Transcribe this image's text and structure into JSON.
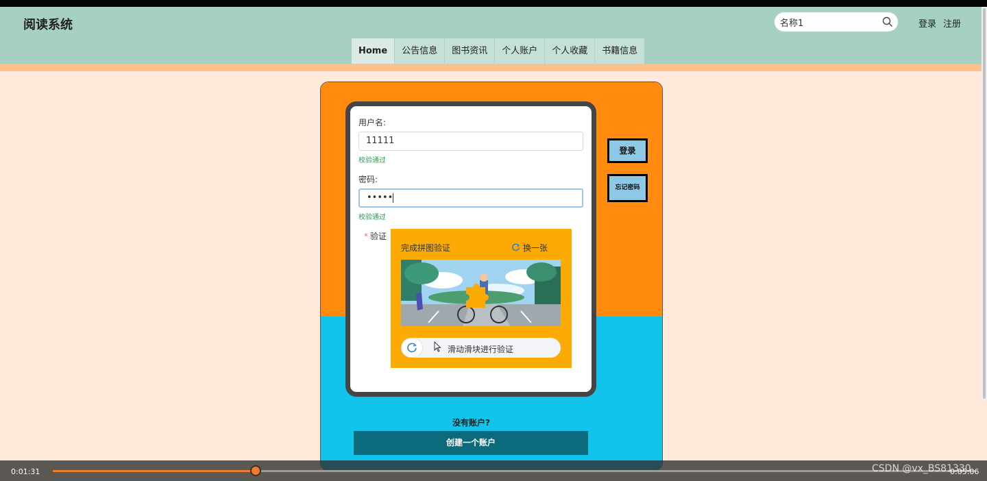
{
  "header": {
    "logo": "阅读系统",
    "search": {
      "value": "名称1"
    },
    "login": "登录",
    "register": "注册"
  },
  "nav": [
    "Home",
    "公告信息",
    "图书资讯",
    "个人账户",
    "个人收藏",
    "书籍信息"
  ],
  "form": {
    "username_label": "用户名:",
    "username_value": "11111",
    "username_status": "校验通过",
    "password_label": "密码:",
    "password_value": "•••••",
    "password_status": "校验通过",
    "captcha_required_mark": "*",
    "captcha_label": "验证"
  },
  "captcha": {
    "title": "完成拼图验证",
    "refresh": "换一张",
    "slider_text": "滑动滑块进行验证"
  },
  "side_buttons": {
    "login": "登录",
    "forgot": "忘记密码"
  },
  "signup": {
    "prompt": "没有账户?",
    "button": "创建一个账户"
  },
  "player": {
    "current": "0:01:31",
    "total": "0:05:06",
    "progress": 0.22
  },
  "watermark": "CSDN @vx_BS81330",
  "colors": {
    "header": "#a6d0c3",
    "card_top": "#ff8a0d",
    "card_bottom": "#12c4ec",
    "captcha_bg": "#fbab03",
    "create_button": "#0b6a7c"
  }
}
